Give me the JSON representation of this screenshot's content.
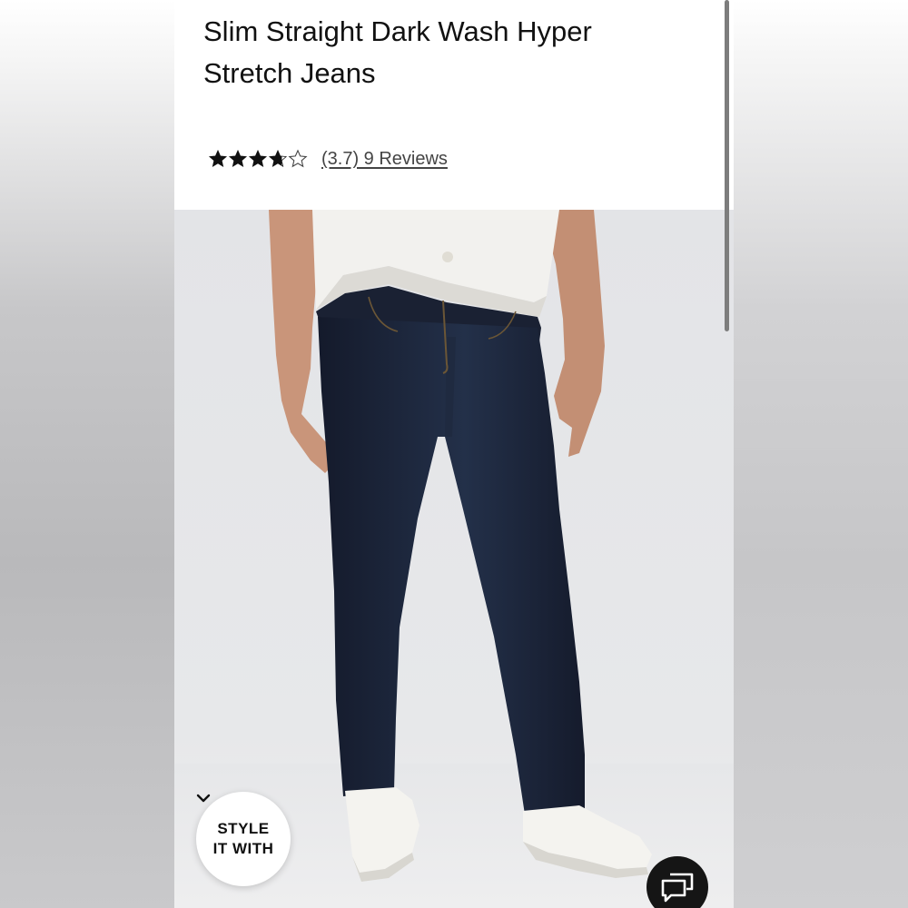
{
  "product": {
    "title": "Slim Straight Dark Wash Hyper Stretch Jeans",
    "rating_value": 3.7,
    "rating_filled_stars": 3.7,
    "rating_max": 5,
    "reviews_link_text": "(3.7) 9 Reviews"
  },
  "image": {
    "description_icon": "product-photo",
    "background_color": "#e4e5e8"
  },
  "style_button": {
    "line1": "STYLE",
    "line2": "IT WITH",
    "icon": "chevron-down-icon"
  },
  "chat_button": {
    "icon": "chat-bubbles-icon",
    "color": "#151515"
  },
  "colors": {
    "denim": "#1b2236",
    "text": "#111111"
  }
}
